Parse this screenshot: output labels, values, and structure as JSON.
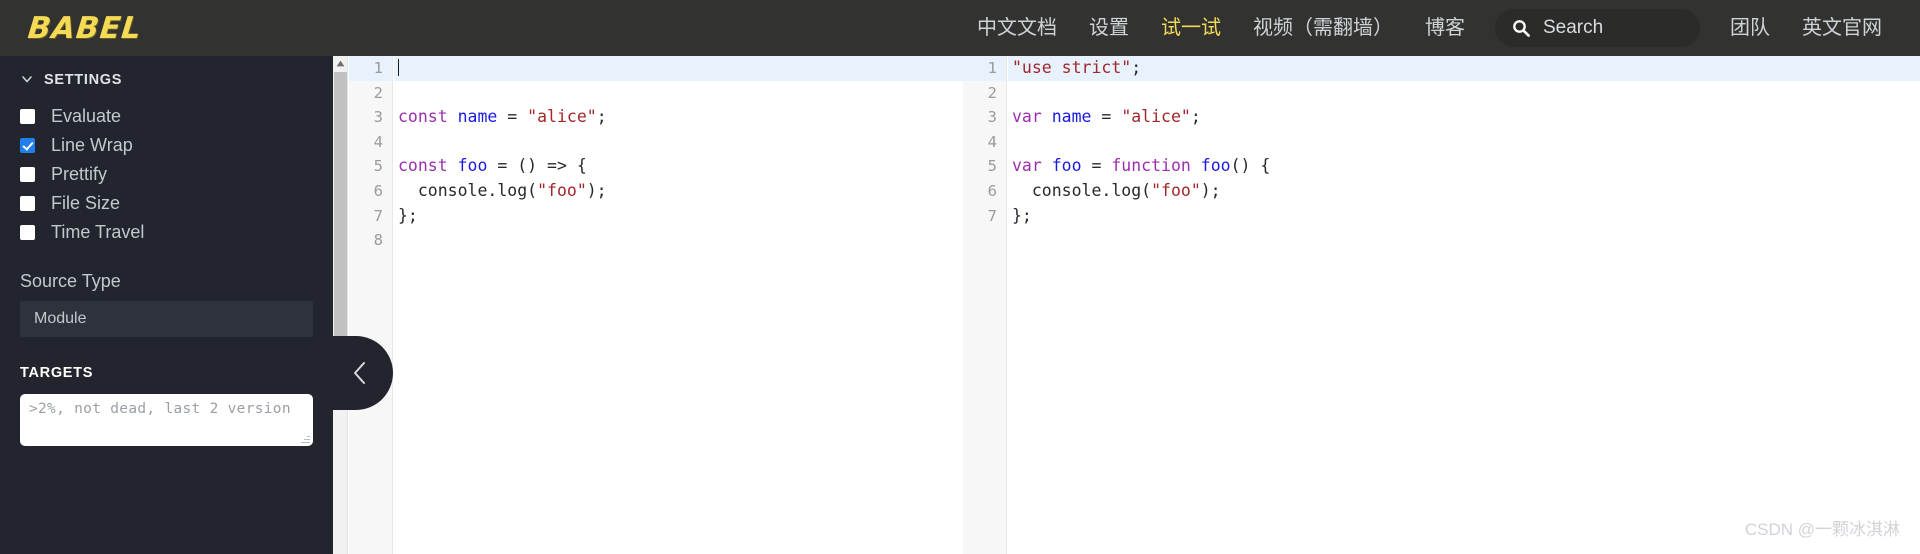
{
  "navbar": {
    "logo": "BABEL",
    "links": [
      {
        "label": "中文文档",
        "active": false
      },
      {
        "label": "设置",
        "active": false
      },
      {
        "label": "试一试",
        "active": true
      },
      {
        "label": "视频（需翻墙）",
        "active": false
      },
      {
        "label": "博客",
        "active": false
      }
    ],
    "search": {
      "placeholder": "Search",
      "icon": "search-icon"
    },
    "links_after_search": [
      {
        "label": "团队",
        "active": false
      },
      {
        "label": "英文官网",
        "active": false
      }
    ]
  },
  "sidebar": {
    "settings": {
      "title": "SETTINGS",
      "expanded_icon": "chevron-down-icon",
      "options": [
        {
          "label": "Evaluate",
          "checked": false
        },
        {
          "label": "Line Wrap",
          "checked": true
        },
        {
          "label": "Prettify",
          "checked": false
        },
        {
          "label": "File Size",
          "checked": false
        },
        {
          "label": "Time Travel",
          "checked": false
        }
      ]
    },
    "source_type": {
      "label": "Source Type",
      "value": "Module"
    },
    "targets": {
      "title": "TARGETS",
      "value": "",
      "placeholder": ">2%, not dead, last 2 version"
    }
  },
  "collapse_button": {
    "icon": "chevron-left-icon"
  },
  "editors": {
    "input": {
      "active_line": 1,
      "line_numbers": [
        "1",
        "2",
        "3",
        "4",
        "5",
        "6",
        "7",
        "8"
      ],
      "lines": [
        "",
        "",
        "const name = \"alice\";",
        "",
        "const foo = () => {",
        "  console.log(\"foo\");",
        "};",
        ""
      ]
    },
    "output": {
      "active_line": 1,
      "line_numbers": [
        "1",
        "2",
        "3",
        "4",
        "5",
        "6",
        "7"
      ],
      "lines": [
        "\"use strict\";",
        "",
        "var name = \"alice\";",
        "",
        "var foo = function foo() {",
        "  console.log(\"foo\");",
        "};"
      ]
    }
  },
  "watermark": "CSDN @一颗冰淇淋",
  "colors": {
    "navbar_bg": "#323330",
    "logo_yellow": "#f5da55",
    "sidebar_bg": "#22252d",
    "checkbox_checked": "#1f7fec",
    "active_line": "#e8f2fd",
    "keyword": "#9b2fae",
    "identifier": "#1a1ae6",
    "string": "#a3262b"
  }
}
